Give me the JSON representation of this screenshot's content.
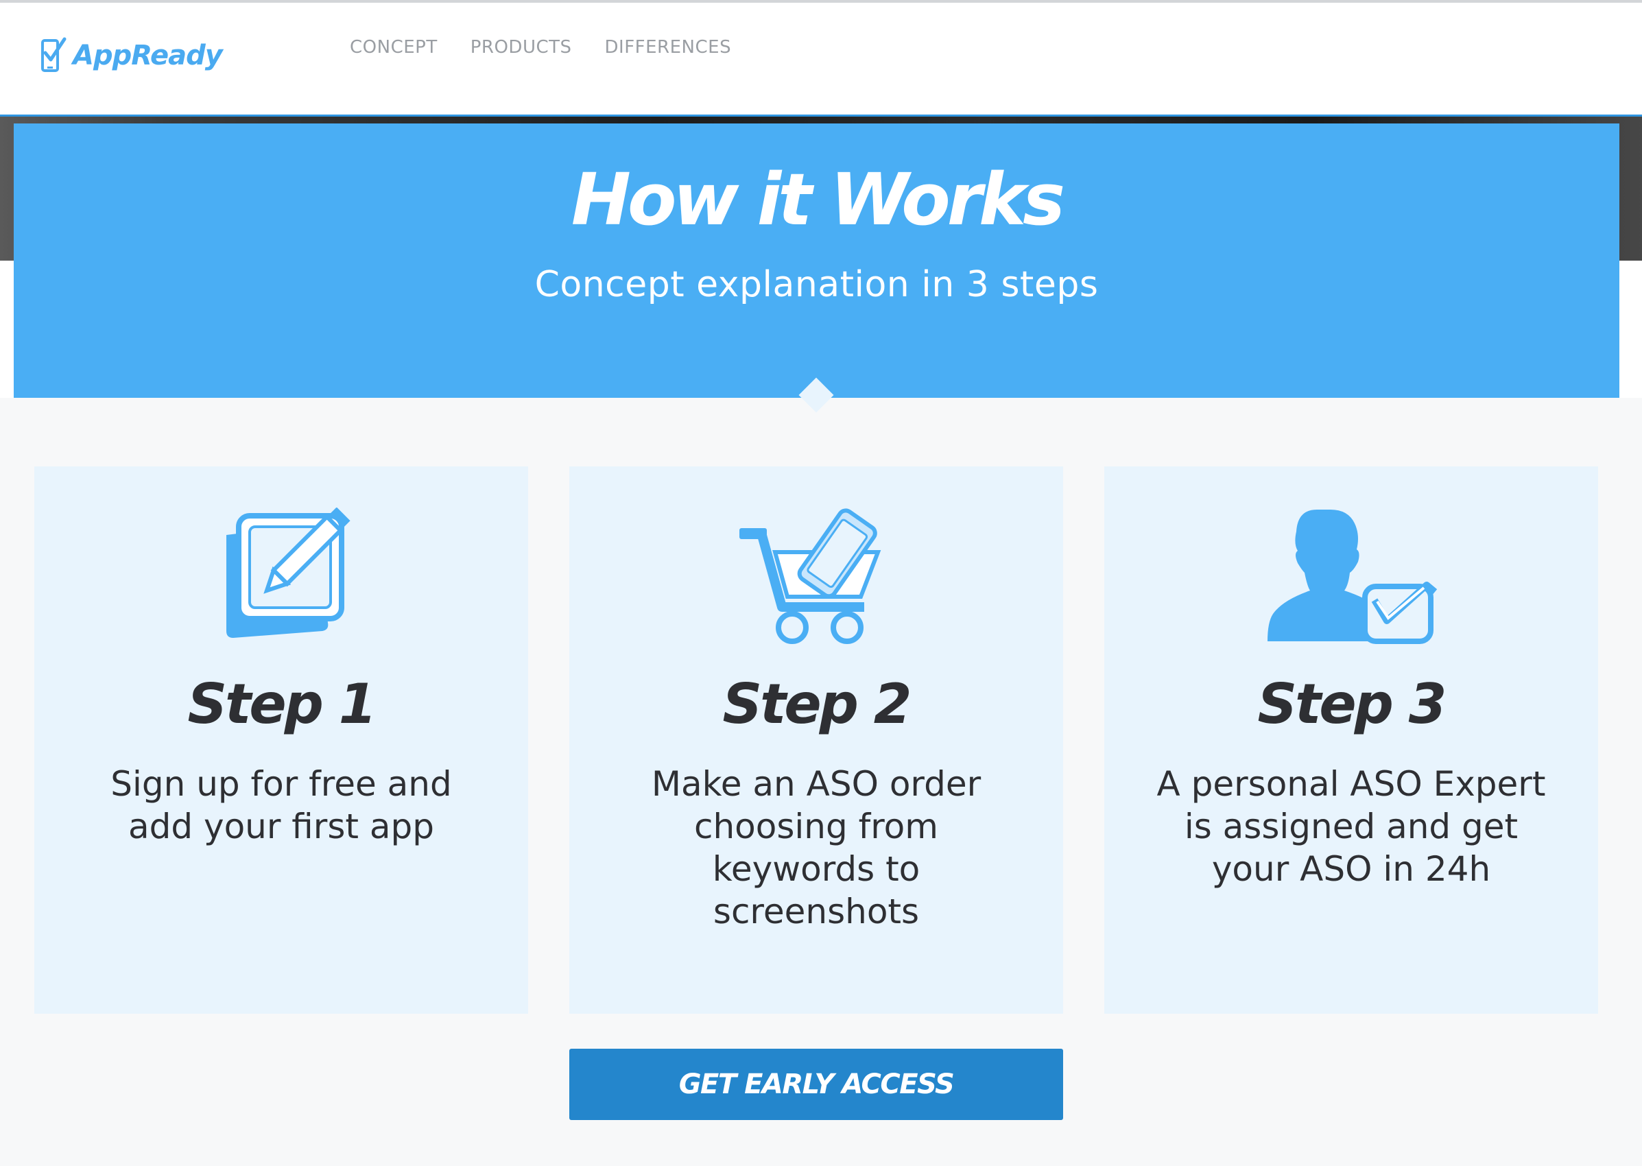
{
  "header": {
    "logo_text": "AppReady",
    "nav": [
      {
        "label": "CONCEPT"
      },
      {
        "label": "PRODUCTS"
      },
      {
        "label": "DIFFERENCES"
      }
    ]
  },
  "hero": {
    "title": "How it Works",
    "subtitle": "Concept explanation in 3 steps"
  },
  "steps": [
    {
      "icon": "edit-pencil-icon",
      "title": "Step 1",
      "description": "Sign up for free and add your first app"
    },
    {
      "icon": "shopping-cart-phone-icon",
      "title": "Step 2",
      "description": "Make an ASO order choosing from keywords to screenshots"
    },
    {
      "icon": "expert-person-check-icon",
      "title": "Step 3",
      "description": "A personal ASO Expert is assigned and get your ASO in 24h"
    }
  ],
  "cta": {
    "label": "GET EARLY ACCESS"
  },
  "colors": {
    "brand_blue": "#4aaef4",
    "cta_blue": "#2486cc",
    "card_bg": "#e8f4fd",
    "text_dark": "#2e2f33"
  }
}
